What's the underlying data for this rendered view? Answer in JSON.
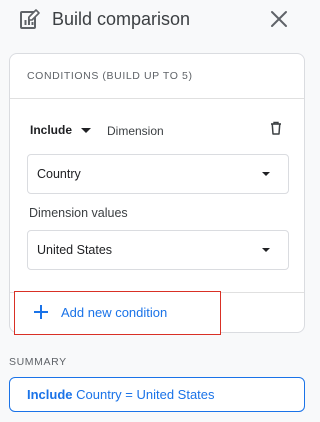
{
  "header": {
    "title": "Build comparison",
    "icon": "comparison-chart-icon",
    "close_icon": "close-icon"
  },
  "conditions": {
    "title": "CONDITIONS (BUILD UP TO 5)",
    "include_label": "Include",
    "dimension_label": "Dimension",
    "dimension_select": "Country",
    "dimension_values_label": "Dimension values",
    "dimension_values_select": "United States",
    "delete_icon": "trash-icon"
  },
  "add_condition": {
    "label": "Add new condition",
    "icon": "plus-icon"
  },
  "summary": {
    "label": "SUMMARY",
    "include": "Include",
    "expression": "Country = United States"
  },
  "colors": {
    "accent": "#1a73e8",
    "highlight_border": "#d93025",
    "background": "#f8f9fa"
  }
}
